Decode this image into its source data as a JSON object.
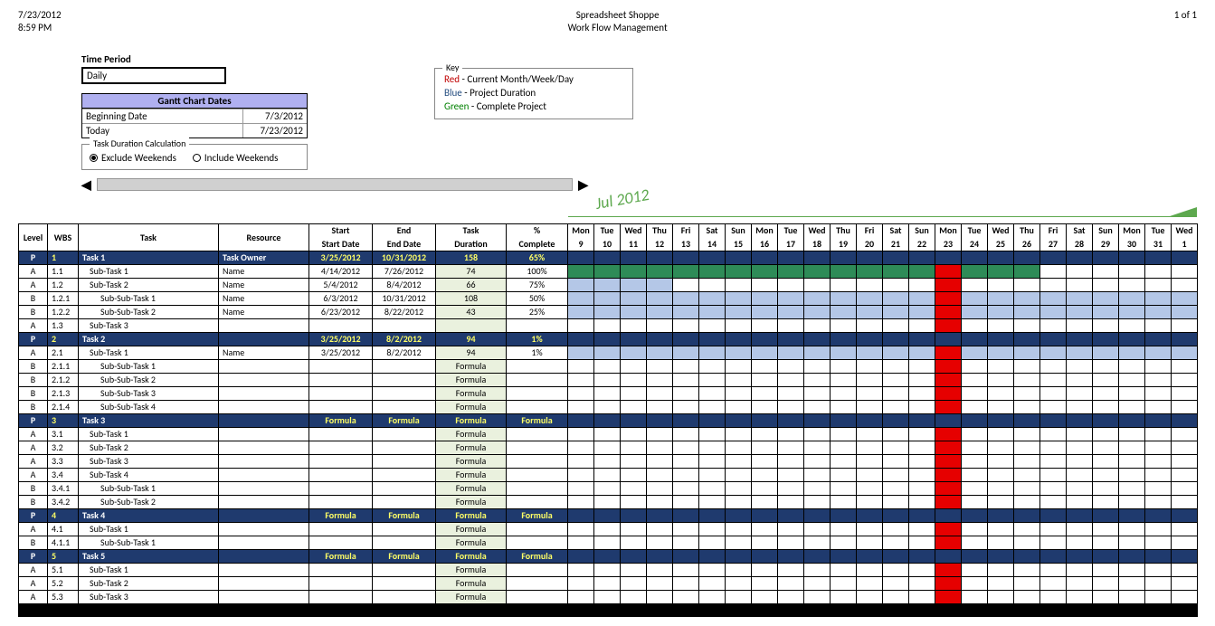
{
  "header": {
    "date": "7/23/2012",
    "time": "8:59 PM",
    "company": "Spreadsheet Shoppe",
    "title": "Work Flow Management",
    "page": "1 of 1"
  },
  "controls": {
    "time_period_label": "Time Period",
    "time_period_value": "Daily",
    "gantt_dates_header": "Gantt Chart Dates",
    "beginning_date_label": "Beginning Date",
    "beginning_date_value": "7/3/2012",
    "today_label": "Today",
    "today_value": "7/23/2012",
    "task_duration_legend": "Task Duration Calculation",
    "exclude_weekends": "Exclude Weekends",
    "include_weekends": "Include Weekends",
    "weekend_mode": "exclude"
  },
  "key": {
    "legend": "Key",
    "red_label": "Red",
    "red_desc": " - Current Month/Week/Day",
    "blue_label": "Blue",
    "blue_desc": " - Project Duration",
    "green_label": "Green",
    "green_desc": " - Complete Project"
  },
  "month_label": "Jul 2012",
  "columns": {
    "level": "Level",
    "wbs": "WBS",
    "task": "Task",
    "resource": "Resource",
    "start1": "Start",
    "start2": "Start Date",
    "end1": "End",
    "end2": "End Date",
    "dur1": "Task",
    "dur2": "Duration",
    "comp1": "%",
    "comp2": "Complete"
  },
  "day_headers": [
    {
      "dow": "Mon",
      "num": "9"
    },
    {
      "dow": "Tue",
      "num": "10"
    },
    {
      "dow": "Wed",
      "num": "11"
    },
    {
      "dow": "Thu",
      "num": "12"
    },
    {
      "dow": "Fri",
      "num": "13"
    },
    {
      "dow": "Sat",
      "num": "14"
    },
    {
      "dow": "Sun",
      "num": "15"
    },
    {
      "dow": "Mon",
      "num": "16"
    },
    {
      "dow": "Tue",
      "num": "17"
    },
    {
      "dow": "Wed",
      "num": "18"
    },
    {
      "dow": "Thu",
      "num": "19"
    },
    {
      "dow": "Fri",
      "num": "20"
    },
    {
      "dow": "Sat",
      "num": "21"
    },
    {
      "dow": "Sun",
      "num": "22"
    },
    {
      "dow": "Mon",
      "num": "23"
    },
    {
      "dow": "Tue",
      "num": "24"
    },
    {
      "dow": "Wed",
      "num": "25"
    },
    {
      "dow": "Thu",
      "num": "26"
    },
    {
      "dow": "Fri",
      "num": "27"
    },
    {
      "dow": "Sat",
      "num": "28"
    },
    {
      "dow": "Sun",
      "num": "29"
    },
    {
      "dow": "Mon",
      "num": "30"
    },
    {
      "dow": "Tue",
      "num": "31"
    },
    {
      "dow": "Wed",
      "num": "1"
    }
  ],
  "rows": [
    {
      "type": "parent",
      "level": "P",
      "wbs": "1",
      "task": "Task 1",
      "indent": 0,
      "resource": "Task Owner",
      "start": "3/25/2012",
      "end": "10/31/2012",
      "dur": "158",
      "comp": "65%",
      "bars": [
        "g",
        "g",
        "g",
        "g",
        "g",
        "g",
        "g",
        "g",
        "g",
        "g",
        "g",
        "g",
        "g",
        "g",
        "r",
        "g",
        "g",
        "g",
        "g",
        "g",
        "g",
        "g",
        "g",
        "g"
      ]
    },
    {
      "type": "row",
      "level": "A",
      "wbs": "1.1",
      "task": "Sub-Task 1",
      "indent": 1,
      "resource": "Name",
      "start": "4/14/2012",
      "end": "7/26/2012",
      "dur": "74",
      "comp": "100%",
      "bars": [
        "g",
        "g",
        "g",
        "g",
        "g",
        "g",
        "g",
        "g",
        "g",
        "g",
        "g",
        "g",
        "g",
        "g",
        "r",
        "g",
        "g",
        "g",
        "",
        "",
        "",
        "",
        "",
        ""
      ]
    },
    {
      "type": "row",
      "level": "A",
      "wbs": "1.2",
      "task": "Sub-Task 2",
      "indent": 1,
      "resource": "Name",
      "start": "5/4/2012",
      "end": "8/4/2012",
      "dur": "66",
      "comp": "75%",
      "bars": [
        "b",
        "b",
        "b",
        "b",
        "",
        "",
        "",
        "",
        "",
        "",
        "",
        "",
        "",
        "",
        "r",
        "",
        "",
        "",
        "",
        "",
        "",
        "",
        "",
        ""
      ]
    },
    {
      "type": "row",
      "level": "B",
      "wbs": "1.2.1",
      "task": "Sub-Sub-Task 1",
      "indent": 2,
      "resource": "Name",
      "start": "6/3/2012",
      "end": "10/31/2012",
      "dur": "108",
      "comp": "50%",
      "bars": [
        "b",
        "b",
        "b",
        "b",
        "b",
        "b",
        "b",
        "b",
        "b",
        "b",
        "b",
        "b",
        "b",
        "b",
        "r",
        "b",
        "b",
        "b",
        "b",
        "b",
        "b",
        "b",
        "b",
        "b"
      ]
    },
    {
      "type": "row",
      "level": "B",
      "wbs": "1.2.2",
      "task": "Sub-Sub-Task 2",
      "indent": 2,
      "resource": "Name",
      "start": "6/23/2012",
      "end": "8/22/2012",
      "dur": "43",
      "comp": "25%",
      "bars": [
        "b",
        "b",
        "b",
        "b",
        "b",
        "b",
        "b",
        "b",
        "b",
        "b",
        "b",
        "b",
        "b",
        "b",
        "r",
        "b",
        "b",
        "b",
        "b",
        "b",
        "b",
        "b",
        "b",
        "b"
      ]
    },
    {
      "type": "row",
      "level": "A",
      "wbs": "1.3",
      "task": "Sub-Task 3",
      "indent": 1,
      "resource": "",
      "start": "",
      "end": "",
      "dur": "",
      "comp": "",
      "bars": [
        "",
        "",
        "",
        "",
        "",
        "",
        "",
        "",
        "",
        "",
        "",
        "",
        "",
        "",
        "r",
        "",
        "",
        "",
        "",
        "",
        "",
        "",
        "",
        ""
      ]
    },
    {
      "type": "parent",
      "level": "P",
      "wbs": "2",
      "task": "Task 2",
      "indent": 0,
      "resource": "",
      "start": "3/25/2012",
      "end": "8/2/2012",
      "dur": "94",
      "comp": "1%",
      "bars": [
        "b",
        "b",
        "b",
        "b",
        "b",
        "b",
        "b",
        "b",
        "b",
        "b",
        "b",
        "b",
        "b",
        "b",
        "r",
        "b",
        "b",
        "b",
        "b",
        "b",
        "b",
        "b",
        "b",
        "b"
      ]
    },
    {
      "type": "row",
      "level": "A",
      "wbs": "2.1",
      "task": "Sub-Task 1",
      "indent": 1,
      "resource": "Name",
      "start": "3/25/2012",
      "end": "8/2/2012",
      "dur": "94",
      "comp": "1%",
      "bars": [
        "b",
        "b",
        "b",
        "b",
        "b",
        "b",
        "b",
        "b",
        "b",
        "b",
        "b",
        "b",
        "b",
        "b",
        "r",
        "b",
        "b",
        "b",
        "b",
        "b",
        "b",
        "b",
        "b",
        "b"
      ]
    },
    {
      "type": "row",
      "level": "B",
      "wbs": "2.1.1",
      "task": "Sub-Sub-Task 1",
      "indent": 2,
      "resource": "",
      "start": "",
      "end": "",
      "dur": "Formula",
      "comp": "",
      "bars": [
        "",
        "",
        "",
        "",
        "",
        "",
        "",
        "",
        "",
        "",
        "",
        "",
        "",
        "",
        "r",
        "",
        "",
        "",
        "",
        "",
        "",
        "",
        "",
        ""
      ]
    },
    {
      "type": "row",
      "level": "B",
      "wbs": "2.1.2",
      "task": "Sub-Sub-Task 2",
      "indent": 2,
      "resource": "",
      "start": "",
      "end": "",
      "dur": "Formula",
      "comp": "",
      "bars": [
        "",
        "",
        "",
        "",
        "",
        "",
        "",
        "",
        "",
        "",
        "",
        "",
        "",
        "",
        "r",
        "",
        "",
        "",
        "",
        "",
        "",
        "",
        "",
        ""
      ]
    },
    {
      "type": "row",
      "level": "B",
      "wbs": "2.1.3",
      "task": "Sub-Sub-Task 3",
      "indent": 2,
      "resource": "",
      "start": "",
      "end": "",
      "dur": "Formula",
      "comp": "",
      "bars": [
        "",
        "",
        "",
        "",
        "",
        "",
        "",
        "",
        "",
        "",
        "",
        "",
        "",
        "",
        "r",
        "",
        "",
        "",
        "",
        "",
        "",
        "",
        "",
        ""
      ]
    },
    {
      "type": "row",
      "level": "B",
      "wbs": "2.1.4",
      "task": "Sub-Sub-Task 4",
      "indent": 2,
      "resource": "",
      "start": "",
      "end": "",
      "dur": "Formula",
      "comp": "",
      "bars": [
        "",
        "",
        "",
        "",
        "",
        "",
        "",
        "",
        "",
        "",
        "",
        "",
        "",
        "",
        "r",
        "",
        "",
        "",
        "",
        "",
        "",
        "",
        "",
        ""
      ]
    },
    {
      "type": "parent",
      "level": "P",
      "wbs": "3",
      "task": "Task 3",
      "indent": 0,
      "resource": "",
      "start": "Formula",
      "end": "Formula",
      "dur": "Formula",
      "comp": "Formula",
      "bars": [
        "",
        "",
        "",
        "",
        "",
        "",
        "",
        "",
        "",
        "",
        "",
        "",
        "",
        "",
        "r",
        "",
        "",
        "",
        "",
        "",
        "",
        "",
        "",
        ""
      ]
    },
    {
      "type": "row",
      "level": "A",
      "wbs": "3.1",
      "task": "Sub-Task 1",
      "indent": 1,
      "resource": "",
      "start": "",
      "end": "",
      "dur": "Formula",
      "comp": "",
      "bars": [
        "",
        "",
        "",
        "",
        "",
        "",
        "",
        "",
        "",
        "",
        "",
        "",
        "",
        "",
        "r",
        "",
        "",
        "",
        "",
        "",
        "",
        "",
        "",
        ""
      ]
    },
    {
      "type": "row",
      "level": "A",
      "wbs": "3.2",
      "task": "Sub-Task 2",
      "indent": 1,
      "resource": "",
      "start": "",
      "end": "",
      "dur": "Formula",
      "comp": "",
      "bars": [
        "",
        "",
        "",
        "",
        "",
        "",
        "",
        "",
        "",
        "",
        "",
        "",
        "",
        "",
        "r",
        "",
        "",
        "",
        "",
        "",
        "",
        "",
        "",
        ""
      ]
    },
    {
      "type": "row",
      "level": "A",
      "wbs": "3.3",
      "task": "Sub-Task 3",
      "indent": 1,
      "resource": "",
      "start": "",
      "end": "",
      "dur": "Formula",
      "comp": "",
      "bars": [
        "",
        "",
        "",
        "",
        "",
        "",
        "",
        "",
        "",
        "",
        "",
        "",
        "",
        "",
        "r",
        "",
        "",
        "",
        "",
        "",
        "",
        "",
        "",
        ""
      ]
    },
    {
      "type": "row",
      "level": "A",
      "wbs": "3.4",
      "task": "Sub-Task 4",
      "indent": 1,
      "resource": "",
      "start": "",
      "end": "",
      "dur": "Formula",
      "comp": "",
      "bars": [
        "",
        "",
        "",
        "",
        "",
        "",
        "",
        "",
        "",
        "",
        "",
        "",
        "",
        "",
        "r",
        "",
        "",
        "",
        "",
        "",
        "",
        "",
        "",
        ""
      ]
    },
    {
      "type": "row",
      "level": "B",
      "wbs": "3.4.1",
      "task": "Sub-Sub-Task 1",
      "indent": 2,
      "resource": "",
      "start": "",
      "end": "",
      "dur": "Formula",
      "comp": "",
      "bars": [
        "",
        "",
        "",
        "",
        "",
        "",
        "",
        "",
        "",
        "",
        "",
        "",
        "",
        "",
        "r",
        "",
        "",
        "",
        "",
        "",
        "",
        "",
        "",
        ""
      ]
    },
    {
      "type": "row",
      "level": "B",
      "wbs": "3.4.2",
      "task": "Sub-Sub-Task 2",
      "indent": 2,
      "resource": "",
      "start": "",
      "end": "",
      "dur": "Formula",
      "comp": "",
      "bars": [
        "",
        "",
        "",
        "",
        "",
        "",
        "",
        "",
        "",
        "",
        "",
        "",
        "",
        "",
        "r",
        "",
        "",
        "",
        "",
        "",
        "",
        "",
        "",
        ""
      ]
    },
    {
      "type": "parent",
      "level": "P",
      "wbs": "4",
      "task": "Task 4",
      "indent": 0,
      "resource": "",
      "start": "Formula",
      "end": "Formula",
      "dur": "Formula",
      "comp": "Formula",
      "bars": [
        "",
        "",
        "",
        "",
        "",
        "",
        "",
        "",
        "",
        "",
        "",
        "",
        "",
        "",
        "r",
        "",
        "",
        "",
        "",
        "",
        "",
        "",
        "",
        ""
      ]
    },
    {
      "type": "row",
      "level": "A",
      "wbs": "4.1",
      "task": "Sub-Task 1",
      "indent": 1,
      "resource": "",
      "start": "",
      "end": "",
      "dur": "Formula",
      "comp": "",
      "bars": [
        "",
        "",
        "",
        "",
        "",
        "",
        "",
        "",
        "",
        "",
        "",
        "",
        "",
        "",
        "r",
        "",
        "",
        "",
        "",
        "",
        "",
        "",
        "",
        ""
      ]
    },
    {
      "type": "row",
      "level": "B",
      "wbs": "4.1.1",
      "task": "Sub-Sub-Task 1",
      "indent": 2,
      "resource": "",
      "start": "",
      "end": "",
      "dur": "Formula",
      "comp": "",
      "bars": [
        "",
        "",
        "",
        "",
        "",
        "",
        "",
        "",
        "",
        "",
        "",
        "",
        "",
        "",
        "r",
        "",
        "",
        "",
        "",
        "",
        "",
        "",
        "",
        ""
      ]
    },
    {
      "type": "parent",
      "level": "P",
      "wbs": "5",
      "task": "Task 5",
      "indent": 0,
      "resource": "",
      "start": "Formula",
      "end": "Formula",
      "dur": "Formula",
      "comp": "Formula",
      "bars": [
        "",
        "",
        "",
        "",
        "",
        "",
        "",
        "",
        "",
        "",
        "",
        "",
        "",
        "",
        "r",
        "",
        "",
        "",
        "",
        "",
        "",
        "",
        "",
        ""
      ]
    },
    {
      "type": "row",
      "level": "A",
      "wbs": "5.1",
      "task": "Sub-Task 1",
      "indent": 1,
      "resource": "",
      "start": "",
      "end": "",
      "dur": "Formula",
      "comp": "",
      "bars": [
        "",
        "",
        "",
        "",
        "",
        "",
        "",
        "",
        "",
        "",
        "",
        "",
        "",
        "",
        "r",
        "",
        "",
        "",
        "",
        "",
        "",
        "",
        "",
        ""
      ]
    },
    {
      "type": "row",
      "level": "A",
      "wbs": "5.2",
      "task": "Sub-Task 2",
      "indent": 1,
      "resource": "",
      "start": "",
      "end": "",
      "dur": "Formula",
      "comp": "",
      "bars": [
        "",
        "",
        "",
        "",
        "",
        "",
        "",
        "",
        "",
        "",
        "",
        "",
        "",
        "",
        "r",
        "",
        "",
        "",
        "",
        "",
        "",
        "",
        "",
        ""
      ]
    },
    {
      "type": "row",
      "level": "A",
      "wbs": "5.3",
      "task": "Sub-Task 3",
      "indent": 1,
      "resource": "",
      "start": "",
      "end": "",
      "dur": "Formula",
      "comp": "",
      "bars": [
        "",
        "",
        "",
        "",
        "",
        "",
        "",
        "",
        "",
        "",
        "",
        "",
        "",
        "",
        "r",
        "",
        "",
        "",
        "",
        "",
        "",
        "",
        "",
        ""
      ]
    }
  ],
  "chart_data": {
    "type": "gantt",
    "title": "Work Flow Management",
    "timeline_start": "7/9/2012",
    "timeline_end": "8/1/2012",
    "today_marker": "7/23/2012",
    "tasks": [
      {
        "wbs": "1",
        "name": "Task 1",
        "start": "3/25/2012",
        "end": "10/31/2012",
        "duration": 158,
        "complete": 0.65
      },
      {
        "wbs": "1.1",
        "name": "Sub-Task 1",
        "start": "4/14/2012",
        "end": "7/26/2012",
        "duration": 74,
        "complete": 1.0
      },
      {
        "wbs": "1.2",
        "name": "Sub-Task 2",
        "start": "5/4/2012",
        "end": "8/4/2012",
        "duration": 66,
        "complete": 0.75
      },
      {
        "wbs": "1.2.1",
        "name": "Sub-Sub-Task 1",
        "start": "6/3/2012",
        "end": "10/31/2012",
        "duration": 108,
        "complete": 0.5
      },
      {
        "wbs": "1.2.2",
        "name": "Sub-Sub-Task 2",
        "start": "6/23/2012",
        "end": "8/22/2012",
        "duration": 43,
        "complete": 0.25
      },
      {
        "wbs": "2",
        "name": "Task 2",
        "start": "3/25/2012",
        "end": "8/2/2012",
        "duration": 94,
        "complete": 0.01
      },
      {
        "wbs": "2.1",
        "name": "Sub-Task 1",
        "start": "3/25/2012",
        "end": "8/2/2012",
        "duration": 94,
        "complete": 0.01
      }
    ]
  }
}
